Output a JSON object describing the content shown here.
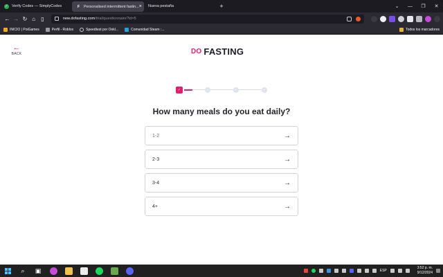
{
  "browser": {
    "tabs": [
      {
        "title": "Verify Codes — SimplyCodes"
      },
      {
        "title": "Personalised intermittent fastin..."
      },
      {
        "title": "Nueva pestaña"
      }
    ],
    "url": {
      "host": "new.dofasting.com",
      "path": "/trial/questionnaire?id=5"
    },
    "bookmarks": [
      "INICIO | PoiGames",
      "Perfil - Roblox",
      "Speedtest por Ookl...",
      "Comunidad Steam :...",
      "Todos los marcadores"
    ]
  },
  "page": {
    "back_label": "BACK",
    "logo": {
      "do": "DO",
      "fasting": "FASTING"
    },
    "progress": {
      "current_step": 1,
      "total_steps": 4
    },
    "question": "How many meals do you eat daily?",
    "options": [
      "1-2",
      "2-3",
      "3-4",
      "4+"
    ]
  },
  "taskbar": {
    "lang": "ESP",
    "time": "3:52 p. m.",
    "date": "9/12/2024"
  },
  "colors": {
    "accent": "#e01f6d",
    "text": "#24242c",
    "border": "#d2d6e0"
  },
  "icons": {
    "back": "arrow-left-icon",
    "option": "arrow-right-icon",
    "step_done": "check-icon"
  }
}
